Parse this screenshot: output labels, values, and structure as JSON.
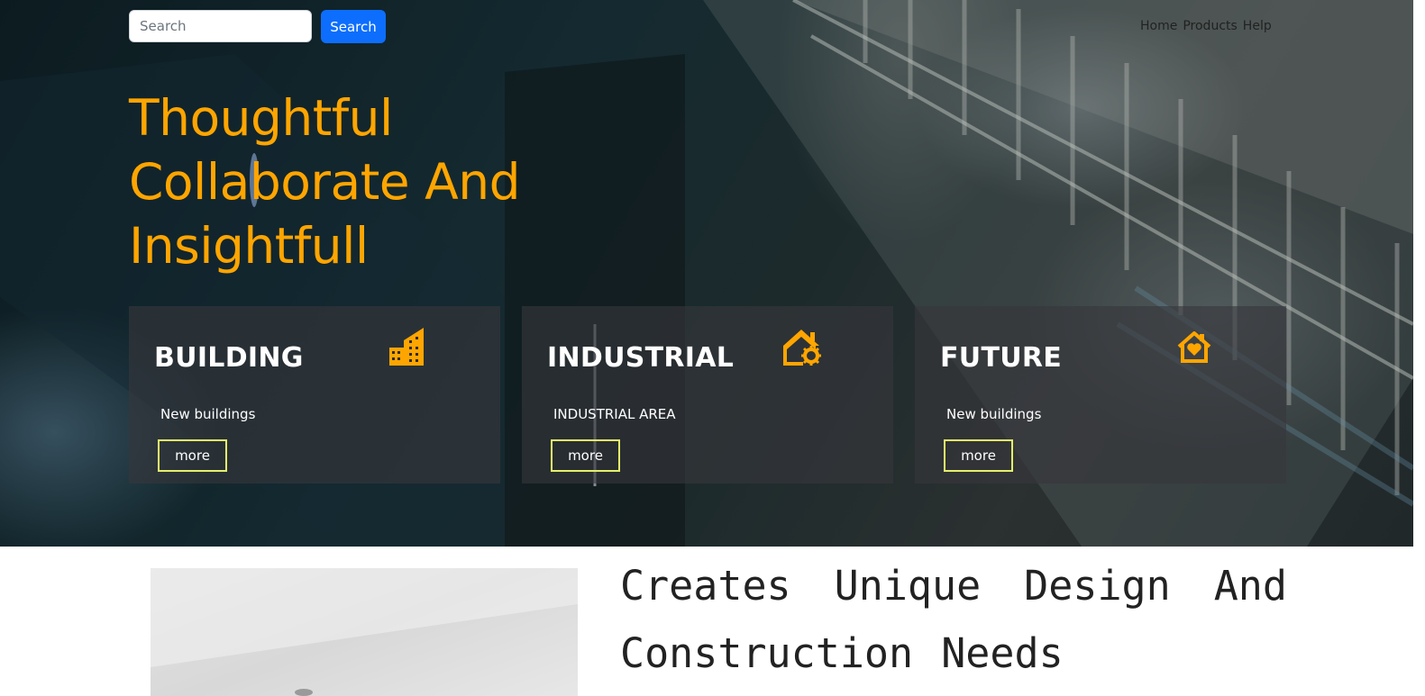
{
  "header": {
    "search": {
      "placeholder": "Search",
      "value": ""
    },
    "search_button_label": "Search",
    "nav": [
      "Home",
      "Products",
      "Help"
    ]
  },
  "hero": {
    "title": "Thoughtful Collaborate And Insightfull",
    "title_color": "#ffa500"
  },
  "cards": [
    {
      "title": "BUILDING",
      "icon": "office-building-icon",
      "description": "New buildings",
      "button_label": "more"
    },
    {
      "title": "INDUSTRIAL",
      "icon": "house-gear-icon",
      "description": "INDUSTRIAL AREA",
      "button_label": "more"
    },
    {
      "title": "FUTURE",
      "icon": "house-heart-icon",
      "description": "New buildings",
      "button_label": "more"
    }
  ],
  "about": {
    "heading": "Creates Unique Design And Construction Needs"
  },
  "colors": {
    "accent": "#ffa500",
    "primary_button": "#0d6efd",
    "more_button_border": "#e5f06a",
    "card_background": "rgba(55,55,60,0.62)"
  }
}
